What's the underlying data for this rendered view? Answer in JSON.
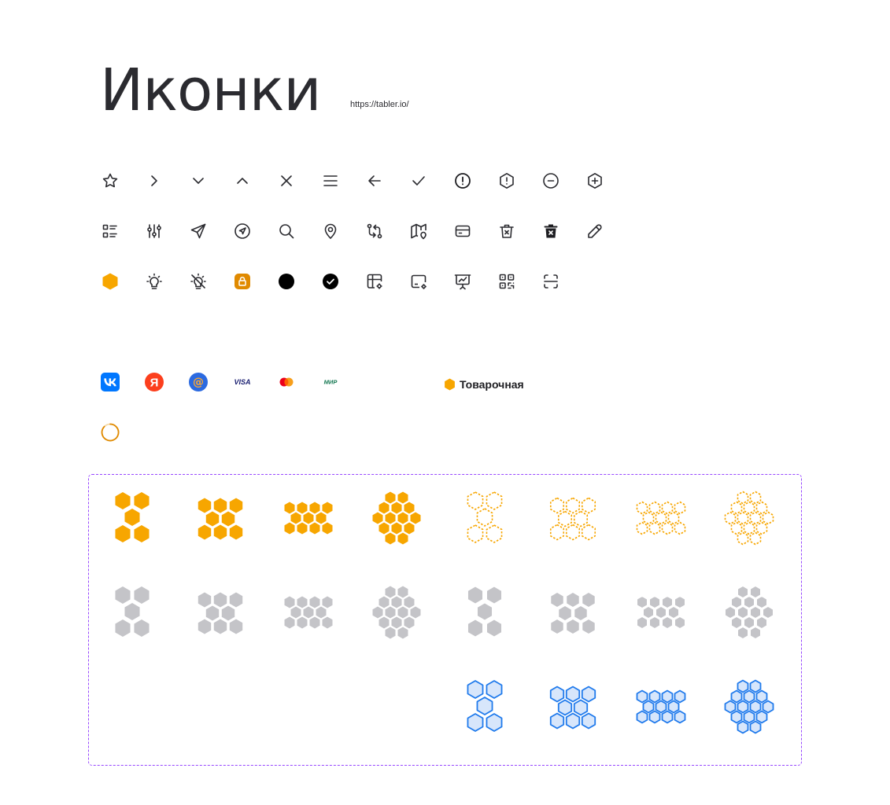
{
  "page": {
    "title": "Иконки",
    "link": "https://tabler.io/"
  },
  "colors": {
    "stroke": "#2b2b30",
    "accent": "#f7a600",
    "accent_dark": "#e08a00",
    "gray": "#c4c4c8",
    "blue": "#1f7aec",
    "blue_fill": "#d7e6fb",
    "vk": "#0077ff",
    "yandex": "#fc3f1d",
    "mail": "#2b6ae0",
    "frame": "#9747ff"
  },
  "icons": {
    "row1": [
      "star-icon",
      "chevron-right-icon",
      "chevron-down-icon",
      "chevron-up-icon",
      "close-icon",
      "menu-icon",
      "arrow-left-icon",
      "check-icon",
      "alert-circle-icon",
      "alert-hexagon-icon",
      "minus-circle-icon",
      "plus-hexagon-icon"
    ],
    "row2": [
      "list-details-icon",
      "adjustments-icon",
      "send-icon",
      "navigation-circle-icon",
      "search-icon",
      "map-pin-icon",
      "switch-arrows-icon",
      "map-pin-map-icon",
      "credit-card-icon",
      "trash-x-icon",
      "trash-x-filled-icon",
      "pencil-icon"
    ],
    "row3": [
      "hexagon-filled-icon",
      "bulb-icon",
      "bulb-off-icon",
      "lock-square-icon",
      "circle-filled-icon",
      "circle-check-filled-icon",
      "table-settings-icon",
      "device-settings-icon",
      "presentation-chart-icon",
      "qrcode-icon",
      "scan-icon"
    ]
  },
  "brands": {
    "vk": "VK",
    "yandex": "Я",
    "mail": "@",
    "visa": "VISA",
    "mastercard": "mastercard-icon",
    "mir": "МИР",
    "logo_text": "Товарочная"
  },
  "hex_clusters": {
    "rows": [
      "orange",
      "gray",
      "blue"
    ],
    "sizes": [
      5,
      7,
      10,
      13
    ]
  }
}
